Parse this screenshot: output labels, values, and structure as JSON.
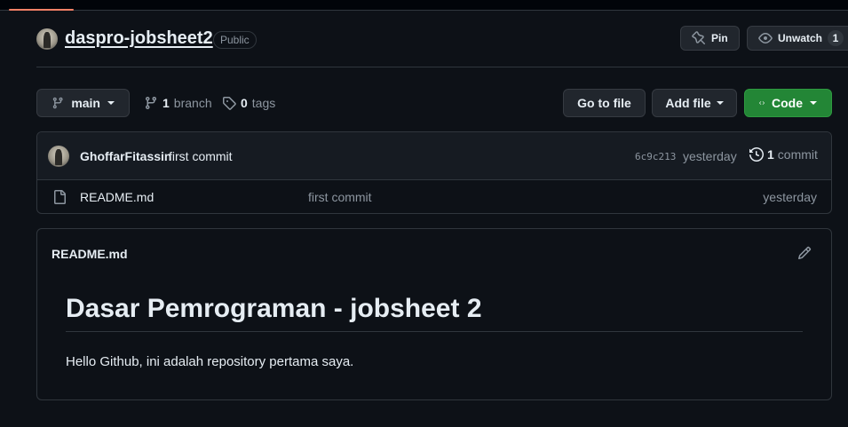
{
  "repo": {
    "name": "daspro-jobsheet2",
    "visibility": "Public",
    "pin_label": "Pin",
    "unwatch_label": "Unwatch",
    "watch_count": "1"
  },
  "toolbar": {
    "branch_name": "main",
    "branch_count": "1",
    "branch_label": "branch",
    "tag_count": "0",
    "tag_label": "tags",
    "go_to_file": "Go to file",
    "add_file": "Add file",
    "code": "Code"
  },
  "latest_commit": {
    "author": "GhoffarFitassin",
    "message": "first commit",
    "sha": "6c9c213",
    "time": "yesterday",
    "count": "1",
    "count_label": "commit"
  },
  "files": [
    {
      "name": "README.md",
      "commit_message": "first commit",
      "time": "yesterday",
      "icon": "file-icon"
    }
  ],
  "readme": {
    "title": "README.md",
    "heading": "Dasar Pemrograman - jobsheet 2",
    "body": "Hello Github, ini adalah repository pertama saya."
  },
  "colors": {
    "background": "#0d1117",
    "border": "#30363d",
    "primary_button": "#238636",
    "muted_text": "#8d96a0",
    "active_tab_underline": "#f78166"
  }
}
